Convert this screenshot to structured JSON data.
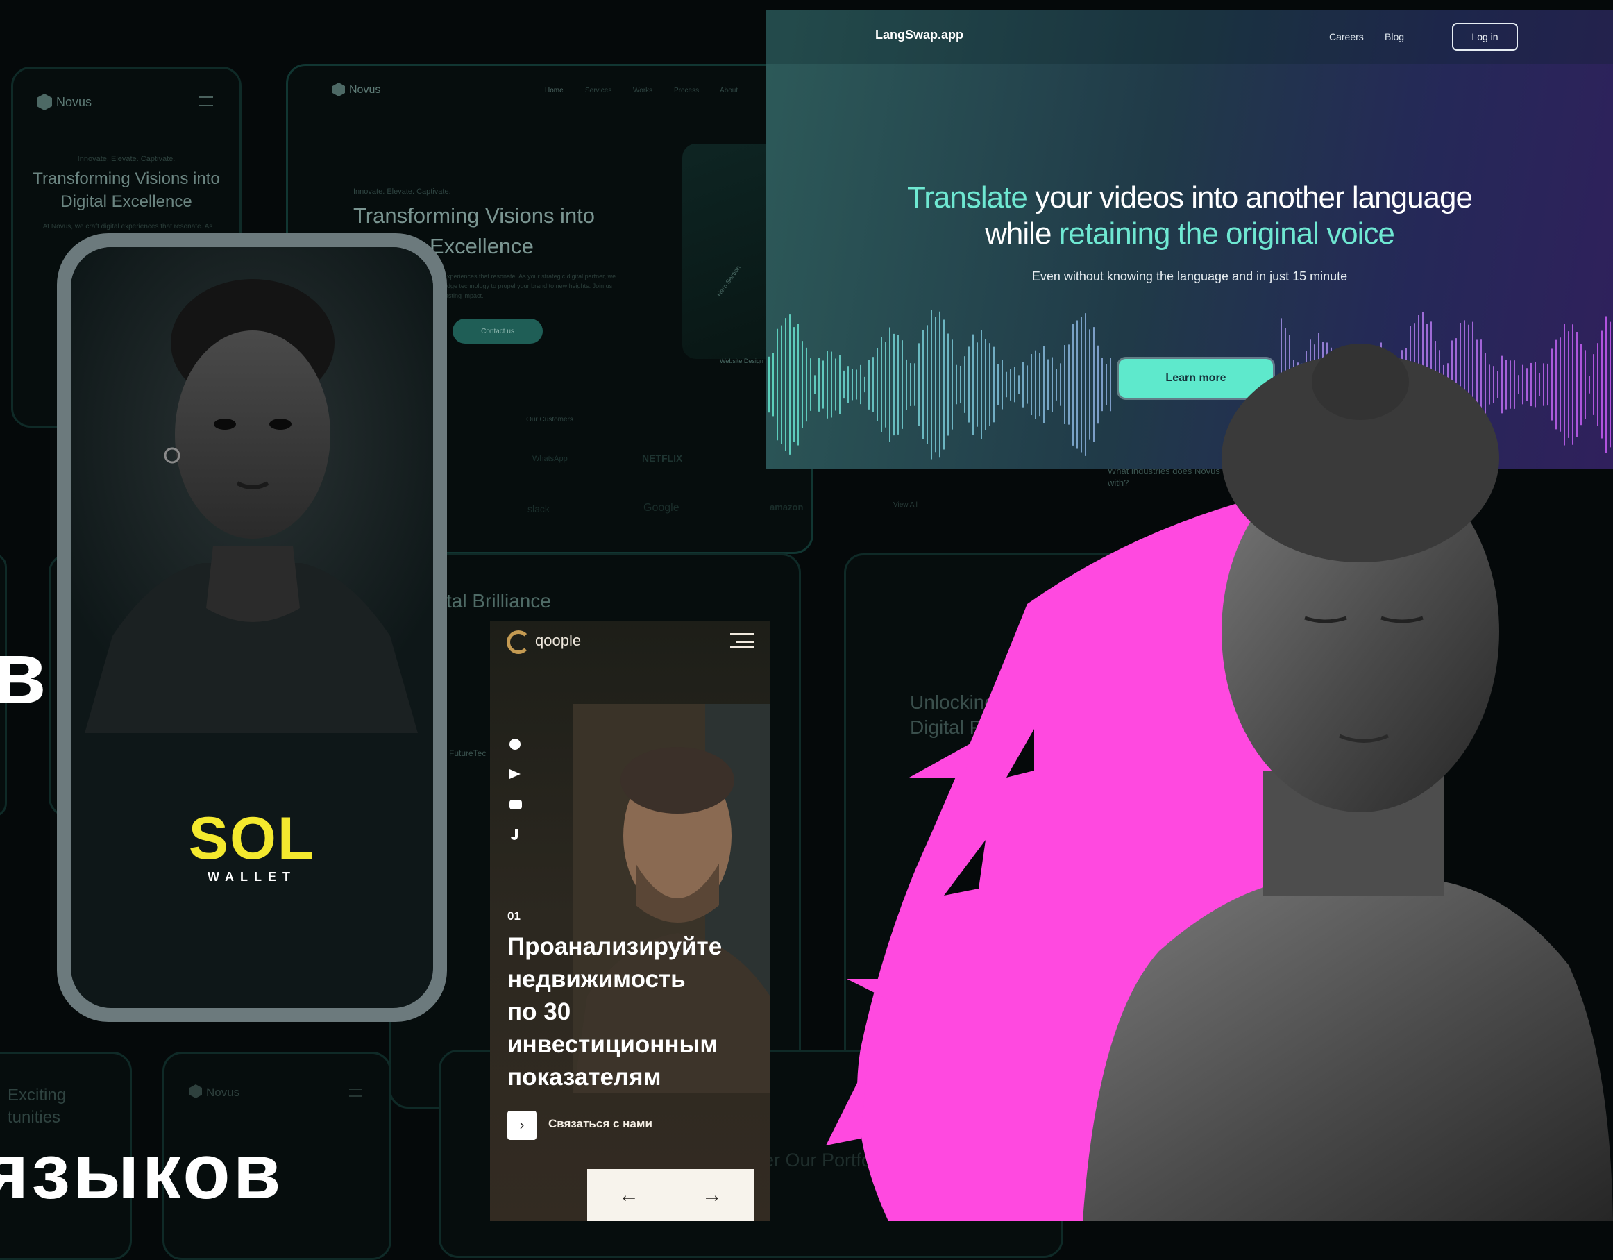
{
  "novus_mobile": {
    "logo": "Novus",
    "tag": "Innovate. Elevate. Captivate.",
    "title_line1": "Transforming Visions into",
    "title_line2": "Digital Excellence",
    "body": "At Novus, we craft digital experiences that resonate. As"
  },
  "novus_desktop": {
    "logo": "Novus",
    "nav": [
      "Home",
      "Services",
      "Works",
      "Process",
      "About"
    ],
    "tag": "Innovate. Elevate. Captivate.",
    "title_line1": "Transforming Visions into",
    "title_line2": "Excellence",
    "body_line1": "experiences that resonate. As your strategic digital partner, we",
    "body_line2": "edge technology to propel your brand to new heights. Join us",
    "body_line3": "lasting impact.",
    "contact": "Contact us",
    "tags": [
      "Hero Section",
      "Website Design"
    ],
    "customers_label": "Our Customers",
    "customers": [
      "WhatsApp",
      "NETFLIX",
      "slack",
      "Google",
      "amazon"
    ],
    "view_all": "View All",
    "faq": "What industries does Novus work with?"
  },
  "langswap": {
    "logo": "LangSwap.app",
    "nav": {
      "careers": "Careers",
      "blog": "Blog",
      "login": "Log in"
    },
    "headline": {
      "a": "Translate",
      "b": " your videos into another language",
      "c": "while ",
      "d": "retaining the original voice"
    },
    "subline": "Even without knowing the language and in just 15 minute",
    "cta": "Learn more"
  },
  "sol_wallet": {
    "title": "SOL",
    "subtitle": "WALLET"
  },
  "bg_cards": {
    "brilliance": "tal Brilliance",
    "unlocking_1": "Unlocking",
    "unlocking_2": "Digital P",
    "futuretec": "FutureTec",
    "exciting_1": "Exciting",
    "exciting_2": "tunities",
    "novus_logo": "Novus",
    "portfolio": "er Our Portfolio"
  },
  "qoople": {
    "name": "qoople",
    "number": "01",
    "headline_lines": [
      "Проанализируйте",
      "недвижимость",
      "по 30",
      "инвестиционным",
      "показателям"
    ],
    "cta": "Связаться с нами",
    "cta_icon": "chevron-right-icon",
    "prev": "←",
    "next": "→"
  },
  "side_text": {
    "letter": "в",
    "word": "языков"
  },
  "colors": {
    "teal": "#6fe8d2",
    "pink": "#ff49e0",
    "sol_yellow": "#f4e92e",
    "cta_teal": "#5ee9cc"
  }
}
